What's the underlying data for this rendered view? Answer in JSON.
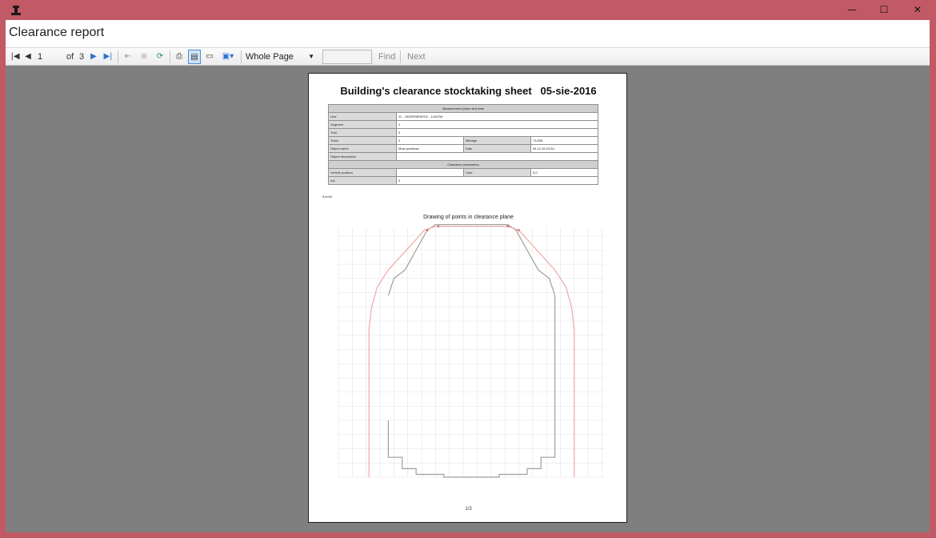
{
  "window": {
    "title": "Clearance report"
  },
  "controls": {
    "minimize": "—",
    "maximize": "☐",
    "close": "✕"
  },
  "toolbar": {
    "page_current": "1",
    "page_of": "of",
    "page_total": "3",
    "zoom": "Whole Page",
    "find_label": "Find",
    "next_label": "Next"
  },
  "report": {
    "title": "Building's clearance stocktaking sheet",
    "date": "05-sie-2016",
    "measurement_header": "Measurement place and date",
    "line_label": "Line",
    "line_value": "12 - SKIERNIEWICE - ŁUKÓW",
    "segment_label": "Segment",
    "segment_value": "1",
    "trail_label": "Trail",
    "trail_value": "0",
    "track_label": "Track",
    "track_value": "2",
    "mileage_label": "Mileage",
    "mileage_value": "73,835",
    "object_name_label": "Object name",
    "object_name_value": "Most przeslow",
    "date_label": "Date",
    "date_value": "04.12.16 23:34",
    "object_desc_label": "Object description",
    "object_desc_value": "",
    "params_header": "Clearance parameters",
    "vehicle_position_label": "Vehicle position",
    "vehicle_position_value": "",
    "cant_label": "Cant",
    "cant_value": "5,0",
    "arc_label": "Arc",
    "arc_value": "0",
    "speed_note": "5 km/h",
    "page_footer": "1/3"
  },
  "chart_data": {
    "type": "line",
    "title": "Drawing of points in clearance plane",
    "xlabel": "",
    "ylabel": "",
    "xlim": [
      -2400,
      2400
    ],
    "ylim": [
      0,
      4400
    ],
    "grid": true,
    "series": [
      {
        "color": "#9e9e9e",
        "x": [
          -1500,
          -1500,
          -1250,
          -1250,
          -1000,
          -1000,
          -500,
          -500,
          500,
          500,
          1000,
          1000,
          1250,
          1250,
          1500,
          1500,
          1400,
          1200,
          800,
          650,
          -650,
          -800,
          -1200,
          -1400,
          -1500
        ],
        "y": [
          1000,
          350,
          350,
          150,
          150,
          50,
          50,
          0,
          0,
          50,
          50,
          150,
          150,
          350,
          350,
          3200,
          3500,
          3650,
          4350,
          4450,
          4450,
          4350,
          3650,
          3500,
          3200
        ]
      },
      {
        "color": "#f0a8a8",
        "x": [
          -1850,
          -1850,
          -1800,
          -1700,
          -1500,
          -850,
          -650,
          650,
          850,
          1500,
          1700,
          1800,
          1850,
          1850
        ],
        "y": [
          0,
          2600,
          3000,
          3350,
          3650,
          4350,
          4420,
          4420,
          4350,
          3650,
          3350,
          3000,
          2600,
          0
        ]
      }
    ],
    "points": [
      {
        "x": -800,
        "y": 4350
      },
      {
        "x": -600,
        "y": 4420
      },
      {
        "x": 650,
        "y": 4420
      },
      {
        "x": 850,
        "y": 4350
      }
    ]
  }
}
